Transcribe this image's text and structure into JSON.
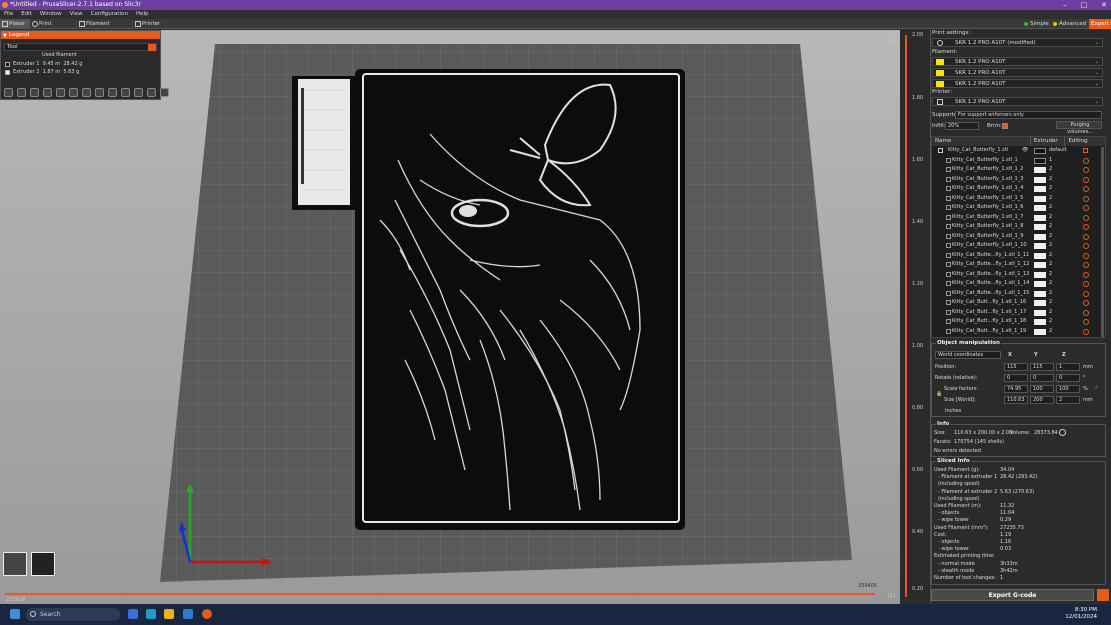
{
  "window": {
    "title": "*Untitled - PrusaSlicer-2.7.1 based on Slic3r"
  },
  "menu": [
    "File",
    "Edit",
    "Window",
    "View",
    "Configuration",
    "Help"
  ],
  "tabs": [
    "Plater",
    "Print Settings",
    "Filament Settings",
    "Printer Settings"
  ],
  "modes": {
    "simple": "Simple",
    "advanced": "Advanced",
    "export": "Expert"
  },
  "legend": {
    "title": "Legend",
    "view_type": "Tool",
    "used_filament_header": "Used filament",
    "extruders": [
      {
        "name": "Extruder 1",
        "length": "9.45 m",
        "weight": "28.42 g",
        "color": "#111111"
      },
      {
        "name": "Extruder 2",
        "length": "1.87 m",
        "weight": "5.63 g",
        "color": "#f0f0f0"
      }
    ]
  },
  "vslider": {
    "top_value": "2.00",
    "top_layer": "(10)",
    "labels": [
      "1.80",
      "1.60",
      "1.40",
      "1.20",
      "1.00",
      "0.80",
      "0.60",
      "0.40"
    ],
    "bottom_value": "0.20",
    "bottom_layer": "(1)"
  },
  "hslider": {
    "left_value": "273619",
    "right_value": "339405"
  },
  "sidebar": {
    "print_settings_label": "Print settings:",
    "print_profile": "SKR 1.2 PRO A10T (modified)",
    "filament_label": "Filament:",
    "filaments": [
      "SKR 1.2 PRO A10T",
      "SKR 1.2 PRO A10T",
      "SKR 1.2 PRO A10T"
    ],
    "printer_label": "Printer:",
    "printer_profile": "SKR 1.2 PRO A10T",
    "supports_label": "Supports:",
    "supports_value": "For support enforcers only",
    "infill_label": "Infill:",
    "infill_value": "20%",
    "brim_label": "Brim:",
    "purging_button": "Purging volumes..."
  },
  "object_list": {
    "headers": {
      "name": "Name",
      "extruder": "Extruder",
      "editing": "Editing"
    },
    "parent": {
      "name": "Kitty_Cat_Butterfly_1.stl",
      "extruder": "default"
    },
    "children": [
      {
        "name": "Kitty_Cat_Butterfly_1.stl_1",
        "extruder": "1"
      },
      {
        "name": "Kitty_Cat_Butterfly_1.stl_1_2",
        "extruder": "2"
      },
      {
        "name": "Kitty_Cat_Butterfly_1.stl_1_3",
        "extruder": "2"
      },
      {
        "name": "Kitty_Cat_Butterfly_1.stl_1_4",
        "extruder": "2"
      },
      {
        "name": "Kitty_Cat_Butterfly_1.stl_1_5",
        "extruder": "2"
      },
      {
        "name": "Kitty_Cat_Butterfly_1.stl_1_6",
        "extruder": "2"
      },
      {
        "name": "Kitty_Cat_Butterfly_1.stl_1_7",
        "extruder": "2"
      },
      {
        "name": "Kitty_Cat_Butterfly_1.stl_1_8",
        "extruder": "2"
      },
      {
        "name": "Kitty_Cat_Butterfly_1.stl_1_9",
        "extruder": "2"
      },
      {
        "name": "Kitty_Cat_Butterfly_1.stl_1_10",
        "extruder": "2"
      },
      {
        "name": "Kitty_Cat_Butte...fly_1.stl_1_11",
        "extruder": "2"
      },
      {
        "name": "Kitty_Cat_Butte...fly_1.stl_1_12",
        "extruder": "2"
      },
      {
        "name": "Kitty_Cat_Butte...fly_1.stl_1_13",
        "extruder": "2"
      },
      {
        "name": "Kitty_Cat_Butte...fly_1.stl_1_14",
        "extruder": "2"
      },
      {
        "name": "Kitty_Cat_Butte...fly_1.stl_1_15",
        "extruder": "2"
      },
      {
        "name": "Kitty_Cat_Butt...fly_1.stl_1_16",
        "extruder": "2"
      },
      {
        "name": "Kitty_Cat_Butt...fly_1.stl_1_17",
        "extruder": "2"
      },
      {
        "name": "Kitty_Cat_Butt...fly_1.stl_1_18",
        "extruder": "2"
      },
      {
        "name": "Kitty_Cat_Butt...fly_1.stl_1_19",
        "extruder": "2"
      }
    ]
  },
  "object_manipulation": {
    "title": "Object manipulation",
    "coords": "World coordinates",
    "axes": [
      "X",
      "Y",
      "Z"
    ],
    "position_label": "Position:",
    "position": [
      "115",
      "115",
      "1"
    ],
    "position_unit": "mm",
    "rotate_label": "Rotate (relative):",
    "rotate": [
      "0",
      "0",
      "0"
    ],
    "rotate_unit": "°",
    "scale_label": "Scale factors:",
    "scale": [
      "74.95",
      "100",
      "100"
    ],
    "scale_unit": "%",
    "size_label": "Size [World]:",
    "size": [
      "110.63",
      "200",
      "2"
    ],
    "size_unit": "mm",
    "inches_label": "Inches"
  },
  "info": {
    "title": "Info",
    "size_label": "Size:",
    "size_value": "110.63 x 200.00 x 2.00",
    "volume_label": "Volume:",
    "volume_value": "28373.84",
    "facets_label": "Facets:",
    "facets_value": "170754 (145 shells)",
    "errors": "No errors detected"
  },
  "sliced_info": {
    "title": "Sliced Info",
    "rows": [
      {
        "label": "Used Filament (g):",
        "value": "34.04"
      },
      {
        "label": "- Filament at extruder 1",
        "value": "28.42 (293.42)"
      },
      {
        "label": "(including spool)",
        "value": ""
      },
      {
        "label": "- Filament at extruder 2",
        "value": "5.63 (270.63)"
      },
      {
        "label": "(including spool)",
        "value": ""
      },
      {
        "label": "Used Filament (m):",
        "value": "11.32"
      },
      {
        "label": "- objects",
        "value": "11.04"
      },
      {
        "label": "- wipe tower",
        "value": "0.29"
      },
      {
        "label": "Used Filament (mm³):",
        "value": "27235.73"
      },
      {
        "label": "Cost:",
        "value": "1.19"
      },
      {
        "label": "- objects",
        "value": "1.16"
      },
      {
        "label": "- wipe tower",
        "value": "0.03"
      },
      {
        "label": "Estimated printing time:",
        "value": ""
      },
      {
        "label": "- normal mode",
        "value": "3h33m"
      },
      {
        "label": "- stealth mode",
        "value": "3h42m"
      },
      {
        "label": "Number of tool changes:",
        "value": "1"
      }
    ]
  },
  "export_button": "Export G-code",
  "taskbar": {
    "search_placeholder": "Search",
    "time": "8:30 PM",
    "date": "12/01/2024"
  }
}
